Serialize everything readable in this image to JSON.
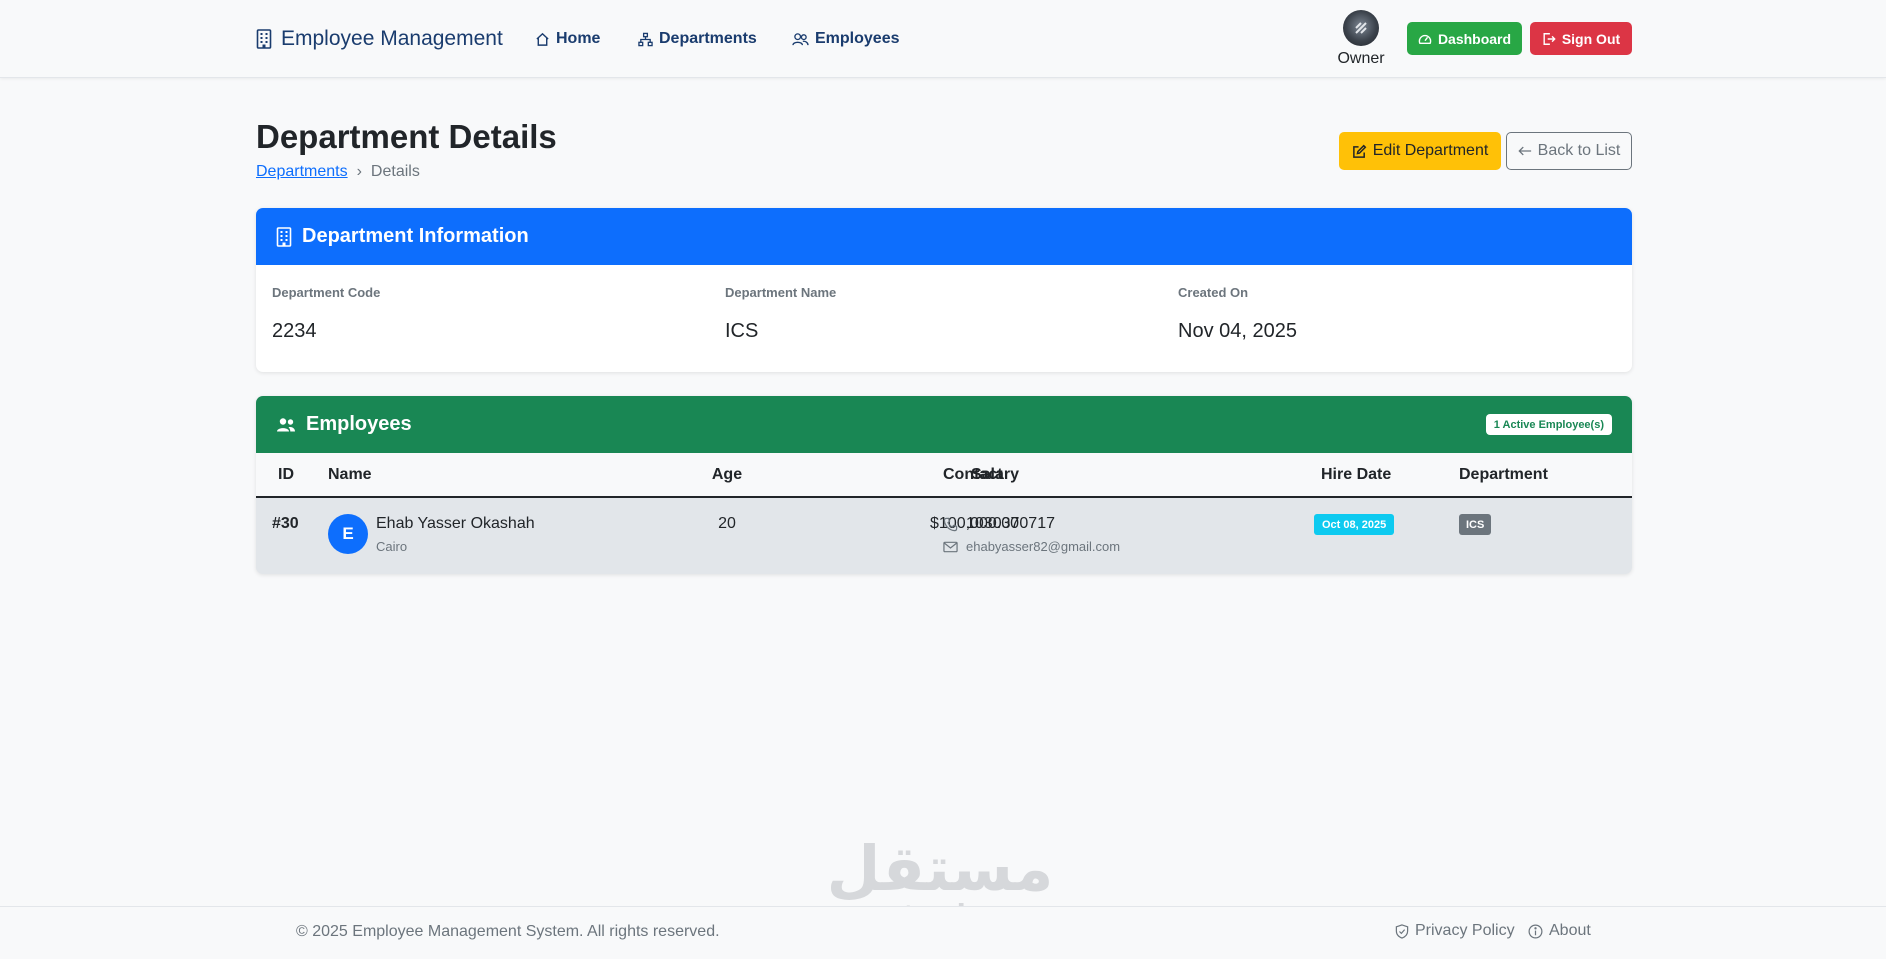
{
  "navbar": {
    "brand": "Employee Management",
    "links": [
      {
        "label": "Home",
        "icon": "house-icon"
      },
      {
        "label": "Departments",
        "icon": "diagram-icon"
      },
      {
        "label": "Employees",
        "icon": "people-icon"
      }
    ],
    "user": {
      "label": "Owner"
    },
    "dashboard_label": "Dashboard",
    "signout_label": "Sign Out"
  },
  "page": {
    "title": "Department Details",
    "breadcrumb": {
      "link": "Departments",
      "separator": "›",
      "current": "Details"
    },
    "edit_label": "Edit Department",
    "back_label": "Back to List"
  },
  "department_card": {
    "title": "Department Information",
    "fields": [
      {
        "label": "Department Code",
        "value": "2234"
      },
      {
        "label": "Department Name",
        "value": "ICS"
      },
      {
        "label": "Created On",
        "value": "Nov 04, 2025"
      }
    ]
  },
  "employees_card": {
    "title": "Employees",
    "badge": "1 Active Employee(s)",
    "columns": [
      "ID",
      "Name",
      "Age",
      "Salary",
      "Contact",
      "Hire Date",
      "Department"
    ],
    "rows": [
      {
        "id": "#30",
        "initial": "E",
        "name": "Ehab Yasser Okashah",
        "city": "Cairo",
        "age": "20",
        "salary": "$100,000.00",
        "phone": "1030370717",
        "email": "ehabyasser82@gmail.com",
        "hire_date": "Oct 08, 2025",
        "department": "ICS"
      }
    ]
  },
  "watermark": {
    "arabic": "مستقل",
    "latin": "mostaql.com"
  },
  "footer": {
    "copyright": "© 2025 Employee Management System. All rights reserved.",
    "privacy_label": "Privacy Policy",
    "about_label": "About"
  },
  "colors": {
    "primary": "#0d6efd",
    "success": "#198754",
    "dashboard": "#28a745",
    "danger": "#dc3545",
    "warning": "#ffc107",
    "info": "#0dcaf0",
    "secondary": "#6c757d",
    "brand_text": "#1a3c6e"
  }
}
